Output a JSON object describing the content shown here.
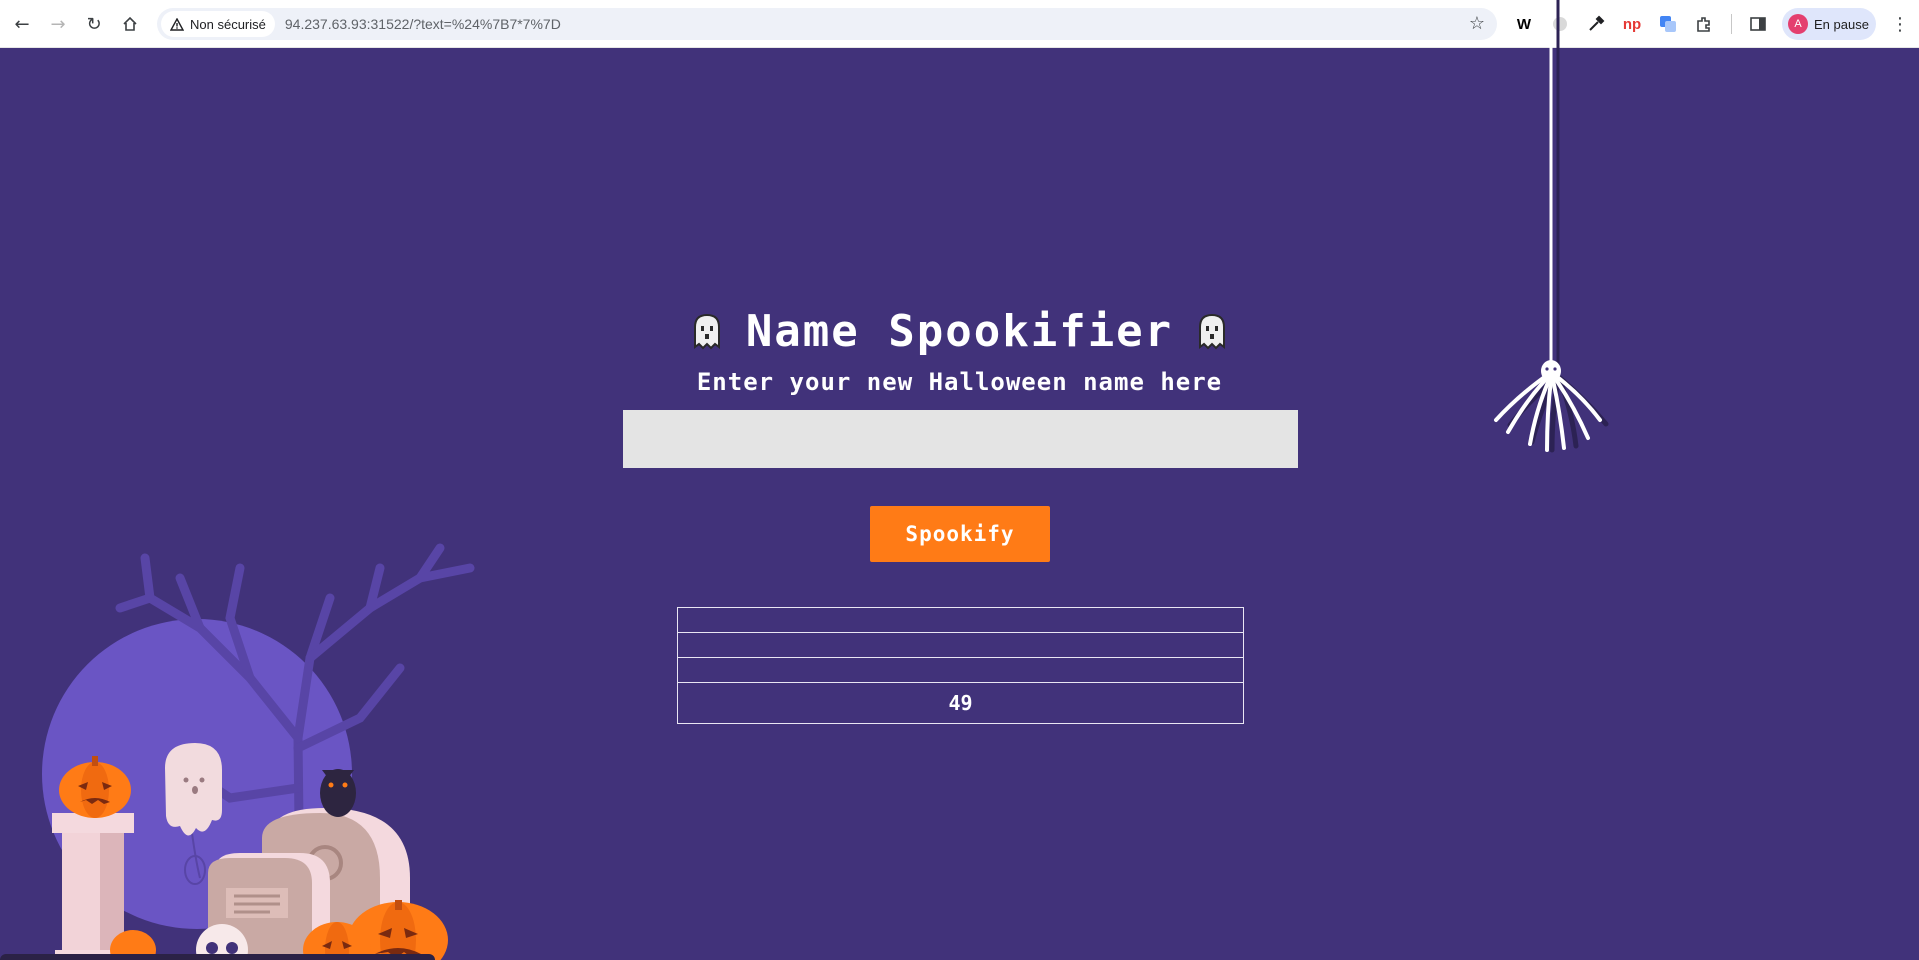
{
  "browser": {
    "security_label": "Non sécurisé",
    "url": "94.237.63.93:31522/?text=%24%7B7*7%7D",
    "profile_initial": "A",
    "profile_status": "En pause",
    "extensions": [
      "W",
      "np"
    ]
  },
  "app": {
    "title": "Name Spookifier",
    "subtitle": "Enter your new Halloween name here",
    "input_value": "",
    "button_label": "Spookify",
    "results": [
      "",
      "",
      "",
      "49"
    ]
  },
  "colors": {
    "background": "#41327a",
    "button": "#ff7b16",
    "input": "#e4e4e4"
  }
}
